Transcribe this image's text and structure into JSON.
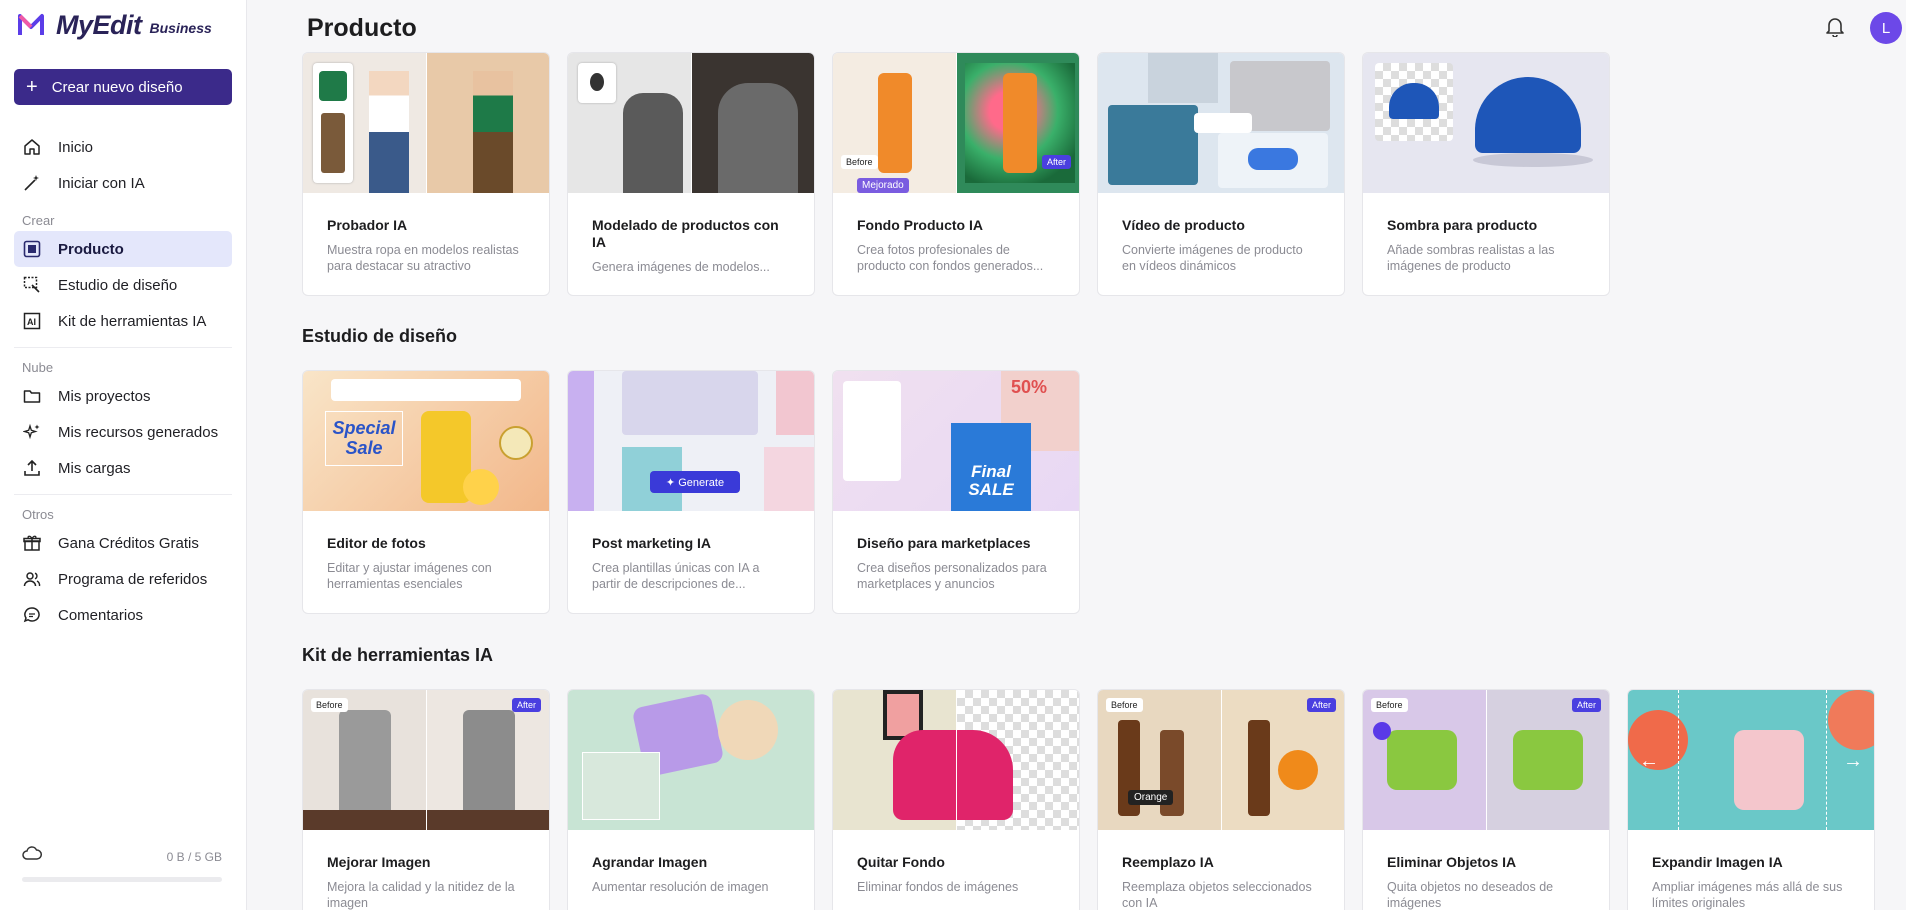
{
  "brand": {
    "name": "MyEdit",
    "tier": "Business"
  },
  "sidebar": {
    "create_label": "Crear nuevo diseño",
    "top_items": [
      {
        "label": "Inicio",
        "icon": "home-icon"
      },
      {
        "label": "Iniciar con IA",
        "icon": "magic-wand-icon"
      }
    ],
    "sections": [
      {
        "title": "Crear",
        "items": [
          {
            "label": "Producto",
            "icon": "product-icon",
            "active": true
          },
          {
            "label": "Estudio de diseño",
            "icon": "design-studio-icon"
          },
          {
            "label": "Kit de herramientas IA",
            "icon": "ai-toolkit-icon"
          }
        ]
      },
      {
        "title": "Nube",
        "items": [
          {
            "label": "Mis proyectos",
            "icon": "folder-icon"
          },
          {
            "label": "Mis recursos generados",
            "icon": "sparkle-icon"
          },
          {
            "label": "Mis cargas",
            "icon": "upload-icon"
          }
        ]
      },
      {
        "title": "Otros",
        "items": [
          {
            "label": "Gana Créditos Gratis",
            "icon": "gift-icon"
          },
          {
            "label": "Programa de referidos",
            "icon": "users-icon"
          },
          {
            "label": "Comentarios",
            "icon": "comment-icon"
          }
        ]
      }
    ],
    "storage": {
      "text": "0 B / 5 GB",
      "used_fraction": 0
    }
  },
  "header": {
    "title": "Producto",
    "avatar_initial": "L"
  },
  "sections": [
    {
      "title": "Producto",
      "show_title": false,
      "cards": [
        {
          "title": "Probador IA",
          "desc": "Muestra ropa en modelos realistas para destacar su atractivo",
          "thumb": "tryon"
        },
        {
          "title": "Modelado de productos con IA",
          "desc": "Genera imágenes de modelos...",
          "thumb": "model"
        },
        {
          "title": "Fondo Producto IA",
          "desc": "Crea fotos profesionales de producto con fondos generados...",
          "thumb": "background",
          "before": "Before",
          "after": "After",
          "badge": "Mejorado"
        },
        {
          "title": "Vídeo de producto",
          "desc": "Convierte imágenes de producto en vídeos dinámicos",
          "thumb": "video"
        },
        {
          "title": "Sombra para producto",
          "desc": "Añade sombras realistas a las imágenes de producto",
          "thumb": "shadow"
        }
      ]
    },
    {
      "title": "Estudio de diseño",
      "show_title": true,
      "cards": [
        {
          "title": "Editor de fotos",
          "desc": "Editar y ajustar imágenes con herramientas esenciales",
          "thumb": "editor",
          "overlay": "Special Sale"
        },
        {
          "title": "Post marketing IA",
          "desc": "Crea plantillas únicas con IA a partir de descripciones de...",
          "thumb": "post",
          "overlay": "Generate"
        },
        {
          "title": "Diseño para marketplaces",
          "desc": "Crea diseños personalizados para marketplaces y anuncios",
          "thumb": "marketplace",
          "overlay": "Final SALE",
          "promo": "50%"
        }
      ]
    },
    {
      "title": "Kit de herramientas IA",
      "show_title": true,
      "cards": [
        {
          "title": "Mejorar Imagen",
          "desc": "Mejora la calidad y la nitidez de la imagen",
          "thumb": "enhance",
          "before": "Before",
          "after": "After"
        },
        {
          "title": "Agrandar Imagen",
          "desc": "Aumentar resolución de imagen",
          "thumb": "upscale"
        },
        {
          "title": "Quitar Fondo",
          "desc": "Eliminar fondos de imágenes",
          "thumb": "removebg"
        },
        {
          "title": "Reemplazo IA",
          "desc": "Reemplaza objetos seleccionados con IA",
          "thumb": "replace",
          "before": "Before",
          "after": "After",
          "overlay": "Orange"
        },
        {
          "title": "Eliminar Objetos IA",
          "desc": "Quita objetos no deseados de imágenes",
          "thumb": "remove",
          "before": "Before",
          "after": "After"
        },
        {
          "title": "Expandir Imagen IA",
          "desc": "Ampliar imágenes más allá de sus límites originales",
          "thumb": "expand"
        }
      ]
    }
  ]
}
